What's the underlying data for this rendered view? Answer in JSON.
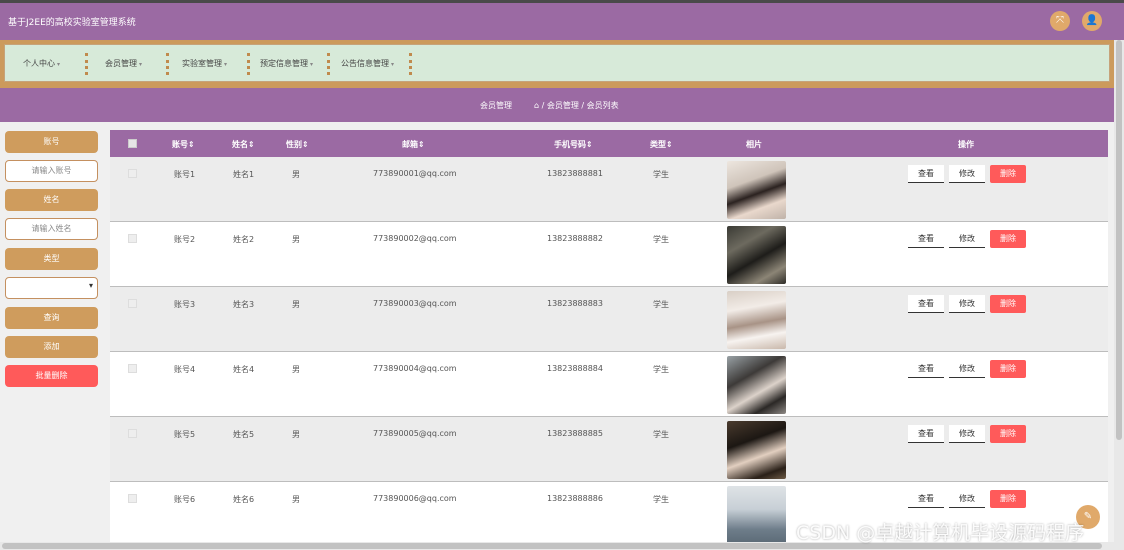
{
  "app": {
    "title": "基于J2EE的高校实验室管理系统",
    "fullscreen_icon": "⤧",
    "user_icon": "👤"
  },
  "nav": {
    "items": [
      {
        "label": "个人中心"
      },
      {
        "label": "会员管理"
      },
      {
        "label": "实验室管理"
      },
      {
        "label": "预定信息管理"
      },
      {
        "label": "公告信息管理"
      }
    ],
    "caret": "▾"
  },
  "breadcrumb": {
    "page_title": "会员管理",
    "path": "⌂ / 会员管理 / 会员列表"
  },
  "filters": {
    "account_label": "账号",
    "account_placeholder": "请输入账号",
    "name_label": "姓名",
    "name_placeholder": "请输入姓名",
    "type_label": "类型",
    "type_selected": "",
    "search_button": "查询",
    "add_button": "添加",
    "bulk_delete_button": "批量删除"
  },
  "table": {
    "headers": {
      "account": "账号⇕",
      "name": "姓名⇕",
      "gender": "性别⇕",
      "email": "邮箱⇕",
      "phone": "手机号码⇕",
      "type": "类型⇕",
      "photo": "相片",
      "actions": "操作"
    },
    "rows": [
      {
        "account": "账号1",
        "name": "姓名1",
        "gender": "男",
        "email": "773890001@qq.com",
        "phone": "13823888881",
        "type": "学生"
      },
      {
        "account": "账号2",
        "name": "姓名2",
        "gender": "男",
        "email": "773890002@qq.com",
        "phone": "13823888882",
        "type": "学生"
      },
      {
        "account": "账号3",
        "name": "姓名3",
        "gender": "男",
        "email": "773890003@qq.com",
        "phone": "13823888883",
        "type": "学生"
      },
      {
        "account": "账号4",
        "name": "姓名4",
        "gender": "男",
        "email": "773890004@qq.com",
        "phone": "13823888884",
        "type": "学生"
      },
      {
        "account": "账号5",
        "name": "姓名5",
        "gender": "男",
        "email": "773890005@qq.com",
        "phone": "13823888885",
        "type": "学生"
      },
      {
        "account": "账号6",
        "name": "姓名6",
        "gender": "男",
        "email": "773890006@qq.com",
        "phone": "13823888886",
        "type": "学生"
      }
    ],
    "view_label": "查看",
    "edit_label": "修改",
    "delete_label": "删除"
  },
  "float_button_icon": "✎",
  "watermark": "CSDN @卓越计算机毕设源码程序",
  "colors": {
    "primary": "#9b6aa3",
    "accent": "#cf9c5d",
    "danger": "#ff5a5a",
    "nav_bg": "#d7ead9"
  }
}
